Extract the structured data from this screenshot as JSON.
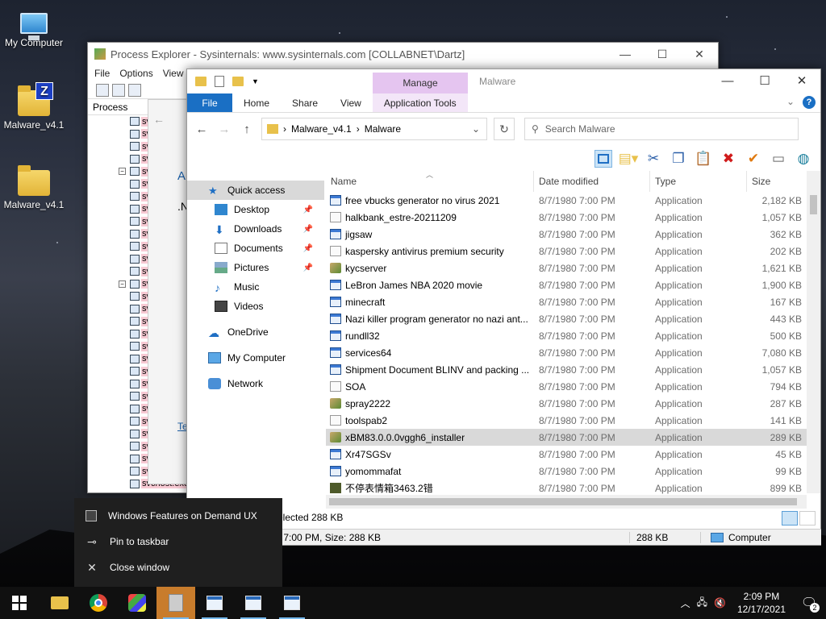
{
  "desktop": {
    "icons": [
      {
        "label": "My Computer",
        "icon": "computer-icon"
      },
      {
        "label": "Malware_v4.1",
        "icon": "zip-folder-icon"
      },
      {
        "label": "Malware_v4.1",
        "icon": "folder-icon"
      }
    ]
  },
  "process_explorer": {
    "title": "Process Explorer - Sysinternals: www.sysinternals.com [COLLABNET\\Dartz]",
    "menu": [
      "File",
      "Options",
      "View"
    ],
    "column_process": "Process",
    "inner_fragments": [
      "A",
      ".N",
      "Te"
    ],
    "visible_process": "svchost.exe",
    "row_prefix": "sv"
  },
  "explorer": {
    "title": "Malware",
    "manage_tab": "Manage",
    "ribbon_tabs": [
      "File",
      "Home",
      "Share",
      "View",
      "Application Tools"
    ],
    "breadcrumb": [
      "Malware_v4.1",
      "Malware"
    ],
    "search_placeholder": "Search Malware",
    "nav": {
      "quick_access": "Quick access",
      "desktop": "Desktop",
      "downloads": "Downloads",
      "documents": "Documents",
      "pictures": "Pictures",
      "music": "Music",
      "videos": "Videos",
      "onedrive": "OneDrive",
      "my_computer": "My Computer",
      "network": "Network"
    },
    "columns": {
      "name": "Name",
      "date": "Date modified",
      "type": "Type",
      "size": "Size"
    },
    "files": [
      {
        "name": "free vbucks generator no virus 2021",
        "date": "8/7/1980 7:00 PM",
        "type": "Application",
        "size": "2,182 KB",
        "icon": "app"
      },
      {
        "name": "halkbank_estre-20211209",
        "date": "8/7/1980 7:00 PM",
        "type": "Application",
        "size": "1,057 KB",
        "icon": "gen"
      },
      {
        "name": "jigsaw",
        "date": "8/7/1980 7:00 PM",
        "type": "Application",
        "size": "362 KB",
        "icon": "app"
      },
      {
        "name": "kaspersky antivirus premium security",
        "date": "8/7/1980 7:00 PM",
        "type": "Application",
        "size": "202 KB",
        "icon": "gen"
      },
      {
        "name": "kycserver",
        "date": "8/7/1980 7:00 PM",
        "type": "Application",
        "size": "1,621 KB",
        "icon": "tool"
      },
      {
        "name": "LeBron James NBA 2020 movie",
        "date": "8/7/1980 7:00 PM",
        "type": "Application",
        "size": "1,900 KB",
        "icon": "app"
      },
      {
        "name": "minecraft",
        "date": "8/7/1980 7:00 PM",
        "type": "Application",
        "size": "167 KB",
        "icon": "app"
      },
      {
        "name": "Nazi killer program generator no nazi ant...",
        "date": "8/7/1980 7:00 PM",
        "type": "Application",
        "size": "443 KB",
        "icon": "app"
      },
      {
        "name": "rundll32",
        "date": "8/7/1980 7:00 PM",
        "type": "Application",
        "size": "500 KB",
        "icon": "app"
      },
      {
        "name": "services64",
        "date": "8/7/1980 7:00 PM",
        "type": "Application",
        "size": "7,080 KB",
        "icon": "app"
      },
      {
        "name": "Shipment Document BLINV and packing ...",
        "date": "8/7/1980 7:00 PM",
        "type": "Application",
        "size": "1,057 KB",
        "icon": "app"
      },
      {
        "name": "SOA",
        "date": "8/7/1980 7:00 PM",
        "type": "Application",
        "size": "794 KB",
        "icon": "gen"
      },
      {
        "name": "spray2222",
        "date": "8/7/1980 7:00 PM",
        "type": "Application",
        "size": "287 KB",
        "icon": "tool"
      },
      {
        "name": "toolspab2",
        "date": "8/7/1980 7:00 PM",
        "type": "Application",
        "size": "141 KB",
        "icon": "gen"
      },
      {
        "name": "xBM83.0.0.0vggh6_installer",
        "date": "8/7/1980 7:00 PM",
        "type": "Application",
        "size": "289 KB",
        "icon": "tool",
        "selected": true
      },
      {
        "name": "Xr47SGSv",
        "date": "8/7/1980 7:00 PM",
        "type": "Application",
        "size": "45 KB",
        "icon": "app"
      },
      {
        "name": "yomommafat",
        "date": "8/7/1980 7:00 PM",
        "type": "Application",
        "size": "99 KB",
        "icon": "app"
      },
      {
        "name": "不停表情箱3463.2错",
        "date": "8/7/1980 7:00 PM",
        "type": "Application",
        "size": "899 KB",
        "icon": "green"
      }
    ],
    "status_selected": "elected  288 KB",
    "details_bar": {
      "left": ") 7:00 PM, Size: 288 KB",
      "size": "288 KB",
      "location": "Computer"
    }
  },
  "jumplist": {
    "app_name": "Windows Features on Demand UX",
    "pin": "Pin to taskbar",
    "close": "Close window"
  },
  "taskbar": {
    "time": "2:09 PM",
    "date": "12/17/2021",
    "notifications": "2"
  }
}
